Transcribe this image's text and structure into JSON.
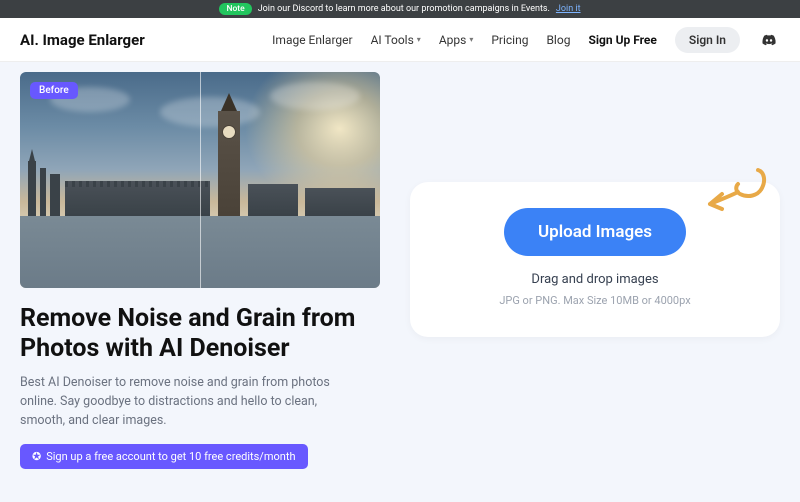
{
  "banner": {
    "note": "Note",
    "text": "Join our Discord to learn more about our promotion campaigns in Events.",
    "link": "Join it"
  },
  "logo": "AI. Image Enlarger",
  "nav": {
    "enlarger": "Image Enlarger",
    "aitools": "AI Tools",
    "apps": "Apps",
    "pricing": "Pricing",
    "blog": "Blog",
    "signup": "Sign Up Free",
    "signin": "Sign In"
  },
  "hero": {
    "before": "Before",
    "title": "Remove Noise and Grain from Photos with AI Denoiser",
    "desc": "Best AI Denoiser to remove noise and grain from photos online. Say goodbye to distractions and hello to clean, smooth, and clear images.",
    "cta": "Sign up a free account to get 10 free credits/month"
  },
  "upload": {
    "btn": "Upload Images",
    "dd": "Drag and drop images",
    "hint": "JPG or PNG. Max Size 10MB or 4000px"
  }
}
